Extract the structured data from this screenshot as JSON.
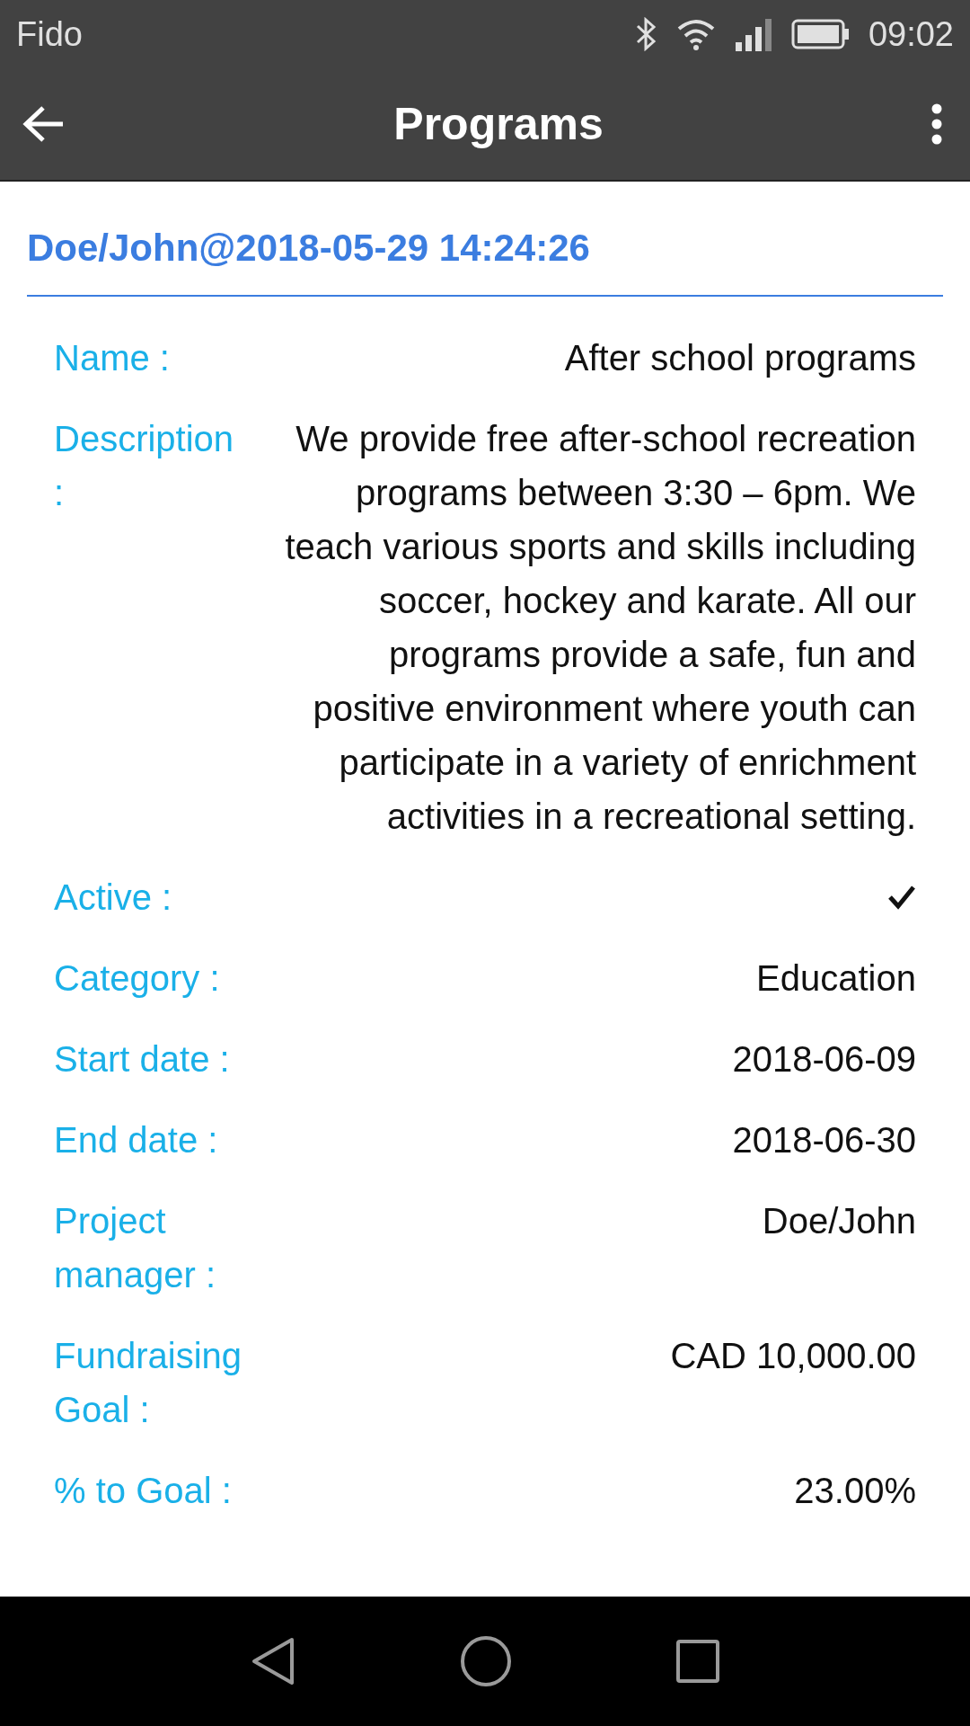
{
  "status_bar": {
    "carrier": "Fido",
    "time": "09:02"
  },
  "app_bar": {
    "title": "Programs"
  },
  "record_title": "Doe/John@2018-05-29 14:24:26",
  "fields": [
    {
      "kind": "text",
      "label": "Name :",
      "value": "After school programs"
    },
    {
      "kind": "text",
      "label": "Description :",
      "value": "We provide free after-school recreation programs between 3:30 – 6pm. We teach various sports and skills including soccer, hockey and karate. All our programs provide a safe, fun and positive environment where youth can participate in a variety of enrichment activities in a recreational setting."
    },
    {
      "kind": "check",
      "label": "Active :",
      "checked": true
    },
    {
      "kind": "text",
      "label": "Category :",
      "value": "Education"
    },
    {
      "kind": "text",
      "label": "Start date :",
      "value": "2018-06-09"
    },
    {
      "kind": "text",
      "label": "End date :",
      "value": "2018-06-30"
    },
    {
      "kind": "text",
      "label": "Project manager :",
      "value": "Doe/John"
    },
    {
      "kind": "text",
      "label": "Fundraising Goal :",
      "value": "CAD 10,000.00"
    },
    {
      "kind": "text",
      "label": "% to Goal :",
      "value": "23.00%"
    }
  ]
}
